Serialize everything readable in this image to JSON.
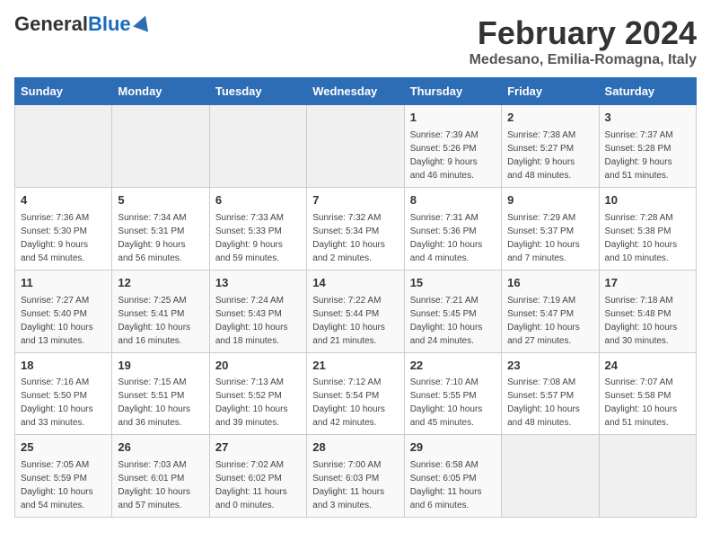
{
  "header": {
    "logo_general": "General",
    "logo_blue": "Blue",
    "month_year": "February 2024",
    "location": "Medesano, Emilia-Romagna, Italy"
  },
  "weekdays": [
    "Sunday",
    "Monday",
    "Tuesday",
    "Wednesday",
    "Thursday",
    "Friday",
    "Saturday"
  ],
  "weeks": [
    [
      {
        "day": "",
        "info": ""
      },
      {
        "day": "",
        "info": ""
      },
      {
        "day": "",
        "info": ""
      },
      {
        "day": "",
        "info": ""
      },
      {
        "day": "1",
        "info": "Sunrise: 7:39 AM\nSunset: 5:26 PM\nDaylight: 9 hours\nand 46 minutes."
      },
      {
        "day": "2",
        "info": "Sunrise: 7:38 AM\nSunset: 5:27 PM\nDaylight: 9 hours\nand 48 minutes."
      },
      {
        "day": "3",
        "info": "Sunrise: 7:37 AM\nSunset: 5:28 PM\nDaylight: 9 hours\nand 51 minutes."
      }
    ],
    [
      {
        "day": "4",
        "info": "Sunrise: 7:36 AM\nSunset: 5:30 PM\nDaylight: 9 hours\nand 54 minutes."
      },
      {
        "day": "5",
        "info": "Sunrise: 7:34 AM\nSunset: 5:31 PM\nDaylight: 9 hours\nand 56 minutes."
      },
      {
        "day": "6",
        "info": "Sunrise: 7:33 AM\nSunset: 5:33 PM\nDaylight: 9 hours\nand 59 minutes."
      },
      {
        "day": "7",
        "info": "Sunrise: 7:32 AM\nSunset: 5:34 PM\nDaylight: 10 hours\nand 2 minutes."
      },
      {
        "day": "8",
        "info": "Sunrise: 7:31 AM\nSunset: 5:36 PM\nDaylight: 10 hours\nand 4 minutes."
      },
      {
        "day": "9",
        "info": "Sunrise: 7:29 AM\nSunset: 5:37 PM\nDaylight: 10 hours\nand 7 minutes."
      },
      {
        "day": "10",
        "info": "Sunrise: 7:28 AM\nSunset: 5:38 PM\nDaylight: 10 hours\nand 10 minutes."
      }
    ],
    [
      {
        "day": "11",
        "info": "Sunrise: 7:27 AM\nSunset: 5:40 PM\nDaylight: 10 hours\nand 13 minutes."
      },
      {
        "day": "12",
        "info": "Sunrise: 7:25 AM\nSunset: 5:41 PM\nDaylight: 10 hours\nand 16 minutes."
      },
      {
        "day": "13",
        "info": "Sunrise: 7:24 AM\nSunset: 5:43 PM\nDaylight: 10 hours\nand 18 minutes."
      },
      {
        "day": "14",
        "info": "Sunrise: 7:22 AM\nSunset: 5:44 PM\nDaylight: 10 hours\nand 21 minutes."
      },
      {
        "day": "15",
        "info": "Sunrise: 7:21 AM\nSunset: 5:45 PM\nDaylight: 10 hours\nand 24 minutes."
      },
      {
        "day": "16",
        "info": "Sunrise: 7:19 AM\nSunset: 5:47 PM\nDaylight: 10 hours\nand 27 minutes."
      },
      {
        "day": "17",
        "info": "Sunrise: 7:18 AM\nSunset: 5:48 PM\nDaylight: 10 hours\nand 30 minutes."
      }
    ],
    [
      {
        "day": "18",
        "info": "Sunrise: 7:16 AM\nSunset: 5:50 PM\nDaylight: 10 hours\nand 33 minutes."
      },
      {
        "day": "19",
        "info": "Sunrise: 7:15 AM\nSunset: 5:51 PM\nDaylight: 10 hours\nand 36 minutes."
      },
      {
        "day": "20",
        "info": "Sunrise: 7:13 AM\nSunset: 5:52 PM\nDaylight: 10 hours\nand 39 minutes."
      },
      {
        "day": "21",
        "info": "Sunrise: 7:12 AM\nSunset: 5:54 PM\nDaylight: 10 hours\nand 42 minutes."
      },
      {
        "day": "22",
        "info": "Sunrise: 7:10 AM\nSunset: 5:55 PM\nDaylight: 10 hours\nand 45 minutes."
      },
      {
        "day": "23",
        "info": "Sunrise: 7:08 AM\nSunset: 5:57 PM\nDaylight: 10 hours\nand 48 minutes."
      },
      {
        "day": "24",
        "info": "Sunrise: 7:07 AM\nSunset: 5:58 PM\nDaylight: 10 hours\nand 51 minutes."
      }
    ],
    [
      {
        "day": "25",
        "info": "Sunrise: 7:05 AM\nSunset: 5:59 PM\nDaylight: 10 hours\nand 54 minutes."
      },
      {
        "day": "26",
        "info": "Sunrise: 7:03 AM\nSunset: 6:01 PM\nDaylight: 10 hours\nand 57 minutes."
      },
      {
        "day": "27",
        "info": "Sunrise: 7:02 AM\nSunset: 6:02 PM\nDaylight: 11 hours\nand 0 minutes."
      },
      {
        "day": "28",
        "info": "Sunrise: 7:00 AM\nSunset: 6:03 PM\nDaylight: 11 hours\nand 3 minutes."
      },
      {
        "day": "29",
        "info": "Sunrise: 6:58 AM\nSunset: 6:05 PM\nDaylight: 11 hours\nand 6 minutes."
      },
      {
        "day": "",
        "info": ""
      },
      {
        "day": "",
        "info": ""
      }
    ]
  ]
}
